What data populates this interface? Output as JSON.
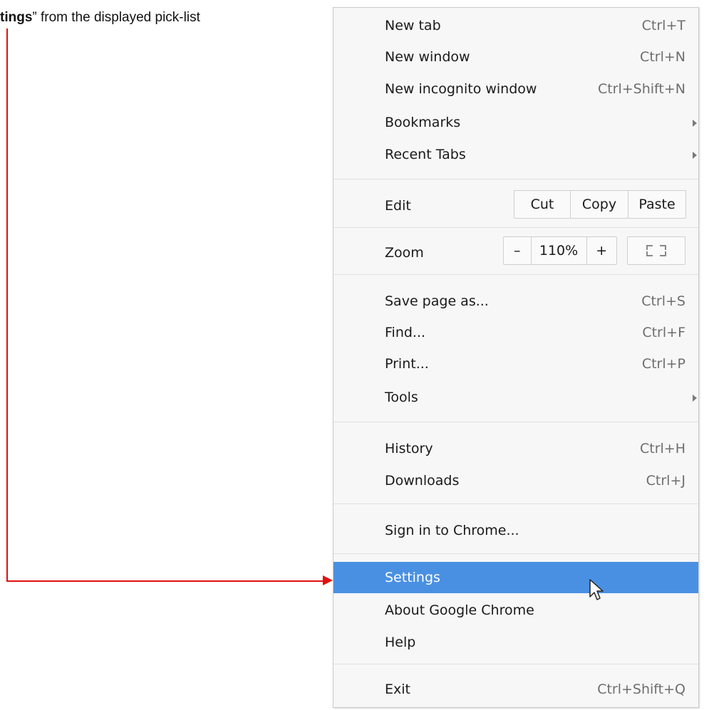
{
  "instruction": {
    "prefix": "",
    "bold": "tings",
    "suffix": "” from the displayed pick-list"
  },
  "menu": {
    "new_tab": {
      "label": "New tab",
      "shortcut": "Ctrl+T"
    },
    "new_window": {
      "label": "New window",
      "shortcut": "Ctrl+N"
    },
    "new_incognito": {
      "label": "New incognito window",
      "shortcut": "Ctrl+Shift+N"
    },
    "bookmarks": {
      "label": "Bookmarks"
    },
    "recent_tabs": {
      "label": "Recent Tabs"
    },
    "edit": {
      "label": "Edit",
      "cut": "Cut",
      "copy": "Copy",
      "paste": "Paste"
    },
    "zoom": {
      "label": "Zoom",
      "minus": "–",
      "level": "110%",
      "plus": "+"
    },
    "save_page": {
      "label": "Save page as...",
      "shortcut": "Ctrl+S"
    },
    "find": {
      "label": "Find...",
      "shortcut": "Ctrl+F"
    },
    "print": {
      "label": "Print...",
      "shortcut": "Ctrl+P"
    },
    "tools": {
      "label": "Tools"
    },
    "history": {
      "label": "History",
      "shortcut": "Ctrl+H"
    },
    "downloads": {
      "label": "Downloads",
      "shortcut": "Ctrl+J"
    },
    "sign_in": {
      "label": "Sign in to Chrome..."
    },
    "settings": {
      "label": "Settings"
    },
    "about": {
      "label": "About Google Chrome"
    },
    "help": {
      "label": "Help"
    },
    "exit": {
      "label": "Exit",
      "shortcut": "Ctrl+Shift+Q"
    }
  },
  "colors": {
    "highlight": "#4a90e2",
    "annotation": "#e01010"
  }
}
